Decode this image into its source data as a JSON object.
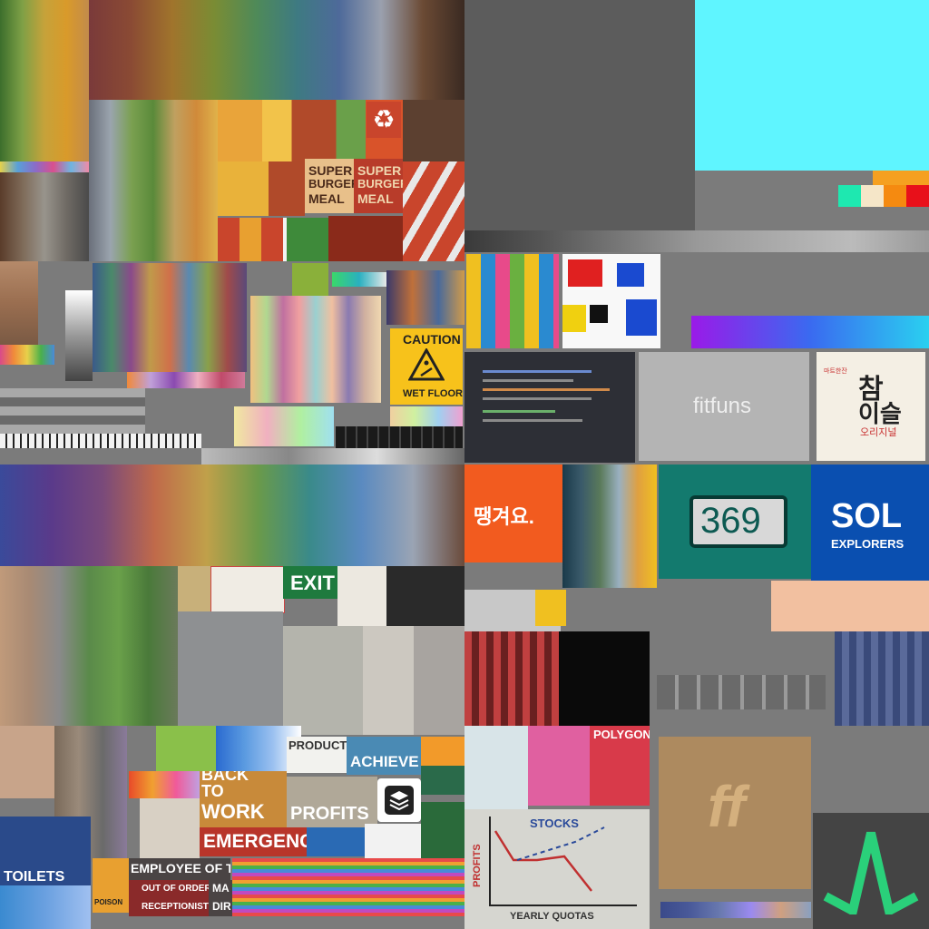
{
  "burger": {
    "line1": "SUPER",
    "line2": "BURGER",
    "line3": "MEAL"
  },
  "caution_sign": {
    "title": "CAUTION",
    "subtitle": "WET FLOOR"
  },
  "exit_sign": "EXIT",
  "logos": {
    "fitfuns": "fitfuns",
    "korean_top": "참",
    "korean_bottom": "이슬",
    "korean_sub": "오리지널",
    "korean_tag": "마트한잔",
    "number_sign": "369",
    "sol_title": "SOL",
    "sol_sub": "EXPLORERS",
    "orange_logo": "땡겨요.",
    "ff_logo": "ff"
  },
  "posters": {
    "product": "PRODUCT",
    "achieve": "ACHIEVE",
    "back_to_work_1": "BACK",
    "back_to_work_2": "TO",
    "back_to_work_3": "WORK",
    "profits": "PROFITS",
    "emergency": "EMERGENCY",
    "employee": "EMPLOYEE OF T",
    "out_of_order": "OUT OF ORDER",
    "receptionist": "RECEPTIONIST",
    "ma": "MA",
    "dir": "DIR",
    "toilets": "TOILETS",
    "polygon": "POLYGON",
    "poison": "POISON"
  },
  "chart_poster": {
    "title": "STOCKS",
    "ylabel": "PROFITS",
    "xlabel": "YEARLY QUOTAS"
  },
  "colors": {
    "cyan": "#5ff5ff",
    "gray_bg": "#7b7b7b",
    "teal": "#137a6e",
    "sol_blue": "#0a4fb0",
    "orange": "#f25b1f",
    "caution_yellow": "#f7c21b"
  }
}
